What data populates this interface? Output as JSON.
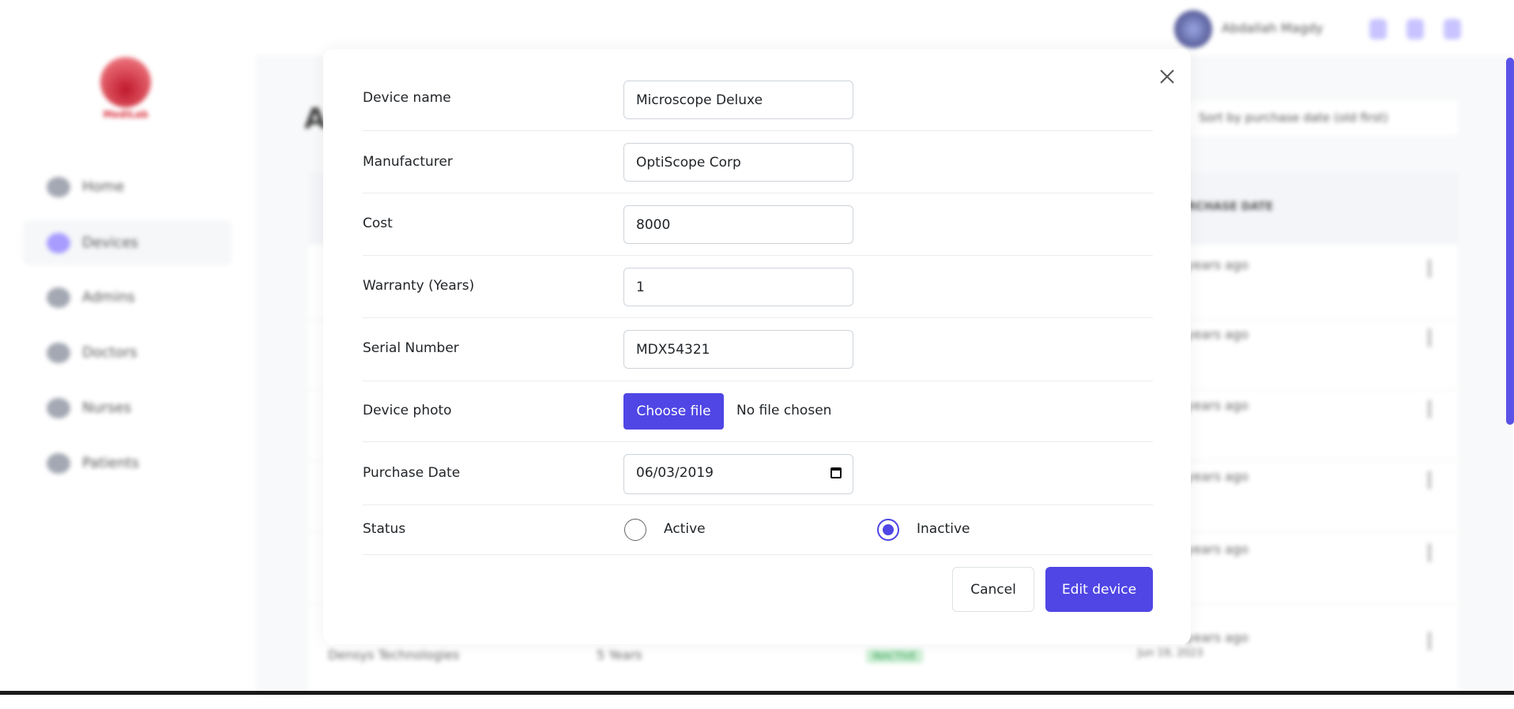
{
  "background": {
    "brand": "MediLab",
    "sidebar": {
      "items": [
        {
          "label": "Home",
          "icon": "home-icon"
        },
        {
          "label": "Devices",
          "icon": "devices-icon",
          "active": true
        },
        {
          "label": "Admins",
          "icon": "admins-icon"
        },
        {
          "label": "Doctors",
          "icon": "doctor-icon"
        },
        {
          "label": "Nurses",
          "icon": "nurse-icon"
        },
        {
          "label": "Patients",
          "icon": "patient-icon"
        }
      ]
    },
    "header": {
      "user_name": "Abdallah Magdy"
    },
    "page_title": "A",
    "sort_label": "Sort by purchase date (old first)",
    "table": {
      "header_date": "PURCHASE DATE",
      "rows_ago": [
        "years ago",
        "years ago",
        "years ago",
        "years ago",
        "years ago",
        "years ago"
      ],
      "last_row": {
        "manufacturer": "Densys Technologies",
        "warranty": "5 Years",
        "status": "INACTIVE",
        "date": "Jun 19, 2023"
      }
    }
  },
  "modal": {
    "fields": {
      "device_name": {
        "label": "Device name",
        "value": "Microscope Deluxe"
      },
      "manufacturer": {
        "label": "Manufacturer",
        "value": "OptiScope Corp"
      },
      "cost": {
        "label": "Cost",
        "value": "8000"
      },
      "warranty": {
        "label": "Warranty (Years)",
        "value": "1"
      },
      "serial": {
        "label": "Serial Number",
        "value": "MDX54321"
      },
      "photo": {
        "label": "Device photo",
        "button": "Choose file",
        "status": "No file chosen"
      },
      "purchase_date": {
        "label": "Purchase Date",
        "value": "06/03/2019"
      },
      "status": {
        "label": "Status",
        "options": [
          "Active",
          "Inactive"
        ],
        "selected": "Inactive"
      }
    },
    "cancel_label": "Cancel",
    "submit_label": "Edit device"
  },
  "colors": {
    "accent": "#4f46e5",
    "brand_red": "#c0192b"
  }
}
